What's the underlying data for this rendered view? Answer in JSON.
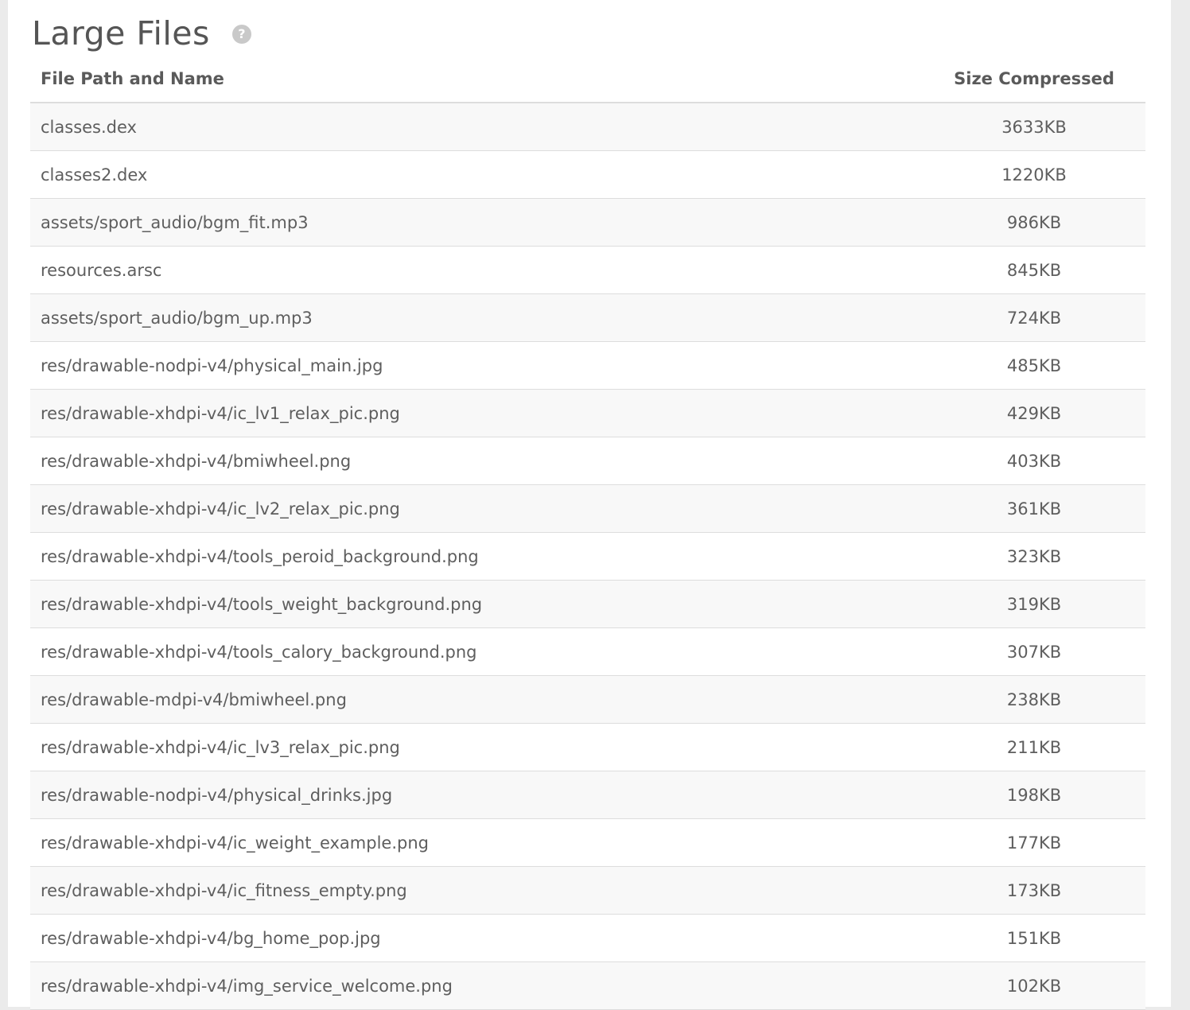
{
  "section": {
    "title": "Large Files",
    "help_icon": "question-circle-icon",
    "help_glyph": "?"
  },
  "table": {
    "columns": [
      "File Path and Name",
      "Size Compressed"
    ],
    "rows": [
      {
        "path": "classes.dex",
        "size": "3633KB"
      },
      {
        "path": "classes2.dex",
        "size": "1220KB"
      },
      {
        "path": "assets/sport_audio/bgm_fit.mp3",
        "size": "986KB"
      },
      {
        "path": "resources.arsc",
        "size": "845KB"
      },
      {
        "path": "assets/sport_audio/bgm_up.mp3",
        "size": "724KB"
      },
      {
        "path": "res/drawable-nodpi-v4/physical_main.jpg",
        "size": "485KB"
      },
      {
        "path": "res/drawable-xhdpi-v4/ic_lv1_relax_pic.png",
        "size": "429KB"
      },
      {
        "path": "res/drawable-xhdpi-v4/bmiwheel.png",
        "size": "403KB"
      },
      {
        "path": "res/drawable-xhdpi-v4/ic_lv2_relax_pic.png",
        "size": "361KB"
      },
      {
        "path": "res/drawable-xhdpi-v4/tools_peroid_background.png",
        "size": "323KB"
      },
      {
        "path": "res/drawable-xhdpi-v4/tools_weight_background.png",
        "size": "319KB"
      },
      {
        "path": "res/drawable-xhdpi-v4/tools_calory_background.png",
        "size": "307KB"
      },
      {
        "path": "res/drawable-mdpi-v4/bmiwheel.png",
        "size": "238KB"
      },
      {
        "path": "res/drawable-xhdpi-v4/ic_lv3_relax_pic.png",
        "size": "211KB"
      },
      {
        "path": "res/drawable-nodpi-v4/physical_drinks.jpg",
        "size": "198KB"
      },
      {
        "path": "res/drawable-xhdpi-v4/ic_weight_example.png",
        "size": "177KB"
      },
      {
        "path": "res/drawable-xhdpi-v4/ic_fitness_empty.png",
        "size": "173KB"
      },
      {
        "path": "res/drawable-xhdpi-v4/bg_home_pop.jpg",
        "size": "151KB"
      },
      {
        "path": "res/drawable-xhdpi-v4/img_service_welcome.png",
        "size": "102KB"
      }
    ]
  }
}
